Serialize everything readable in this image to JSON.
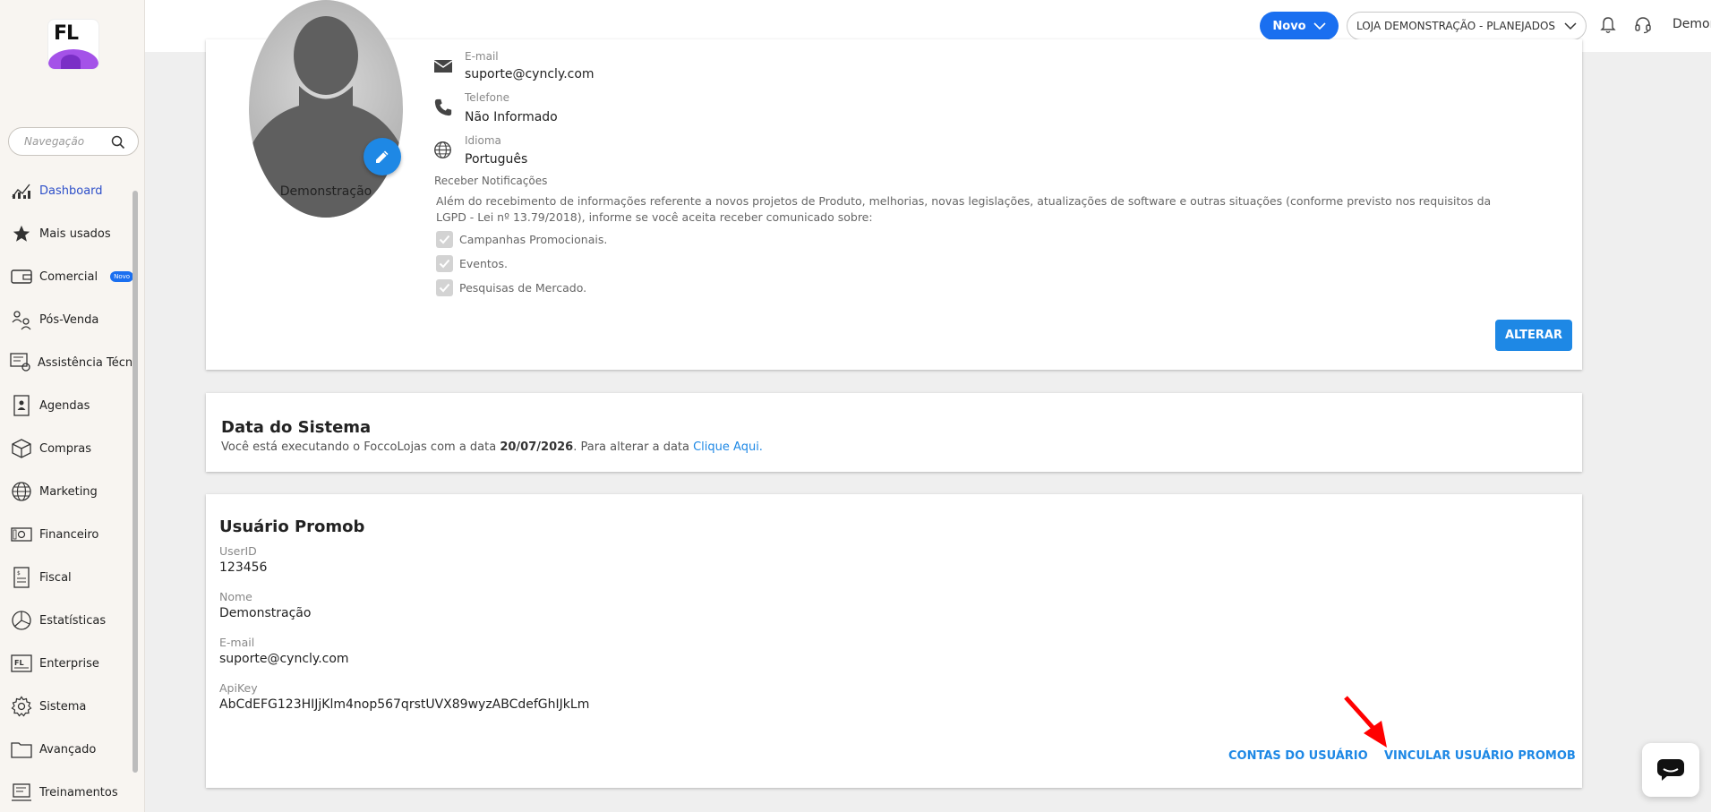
{
  "logo": {
    "text": "FL"
  },
  "sidebar": {
    "search_placeholder": "Navegação",
    "items": [
      {
        "label": "Dashboard",
        "icon": "dashboard-icon",
        "active": true
      },
      {
        "label": "Mais usados",
        "icon": "star-icon"
      },
      {
        "label": "Comercial",
        "icon": "wallet-icon",
        "badge": "Novo"
      },
      {
        "label": "Pós-Venda",
        "icon": "people-icon"
      },
      {
        "label": "Assistência Técn...",
        "icon": "assistance-icon"
      },
      {
        "label": "Agendas",
        "icon": "agenda-icon"
      },
      {
        "label": "Compras",
        "icon": "box-icon"
      },
      {
        "label": "Marketing",
        "icon": "globe-icon"
      },
      {
        "label": "Financeiro",
        "icon": "money-icon"
      },
      {
        "label": "Fiscal",
        "icon": "document-icon"
      },
      {
        "label": "Estatísticas",
        "icon": "pie-chart-icon"
      },
      {
        "label": "Enterprise",
        "icon": "enterprise-icon"
      },
      {
        "label": "Sistema",
        "icon": "gear-icon"
      },
      {
        "label": "Avançado",
        "icon": "folder-icon"
      },
      {
        "label": "Treinamentos",
        "icon": "training-icon"
      }
    ]
  },
  "header": {
    "novo_label": "Novo",
    "store_label": "LOJA DEMONSTRAÇÃO - PLANEJADOS",
    "user_label": "Demonstração"
  },
  "profile": {
    "name": "Demonstração",
    "email_label": "E-mail",
    "email_value": "suporte@cyncly.com",
    "phone_label": "Telefone",
    "phone_value": "Não Informado",
    "language_label": "Idioma",
    "language_value": "Português",
    "notifications_title": "Receber Notificações",
    "notifications_desc": "Além do recebimento de informações referente a novos projetos de Produto, melhorias, novas legislações, atualizações de software e outras situações (conforme previsto nos requisitos da LGPD - Lei nº 13.79/2018), informe se você aceita receber comunicado sobre:",
    "checkboxes": [
      "Campanhas Promocionais.",
      "Eventos.",
      "Pesquisas de Mercado."
    ],
    "alterar_label": "ALTERAR"
  },
  "system_date": {
    "title": "Data do Sistema",
    "text_before": "Você está executando o FoccoLojas com a data ",
    "date": "20/07/2026",
    "text_after": ". Para alterar a data ",
    "link": "Clique Aqui."
  },
  "promob": {
    "title": "Usuário Promob",
    "userid_label": "UserID",
    "userid_value": "123456",
    "name_label": "Nome",
    "name_value": "Demonstração",
    "email_label": "E-mail",
    "email_value": "suporte@cyncly.com",
    "apikey_label": "ApiKey",
    "apikey_value": "AbCdEFG123HIJjKlm4nop567qrstUVX89wyzABCdefGhIJkLm",
    "accounts_label": "CONTAS DO USUÁRIO",
    "link_label": "VINCULAR USUÁRIO PROMOB"
  },
  "colors": {
    "accent": "#1e88e5",
    "primary": "#1a6ff0",
    "annotation": "#ff0000"
  }
}
